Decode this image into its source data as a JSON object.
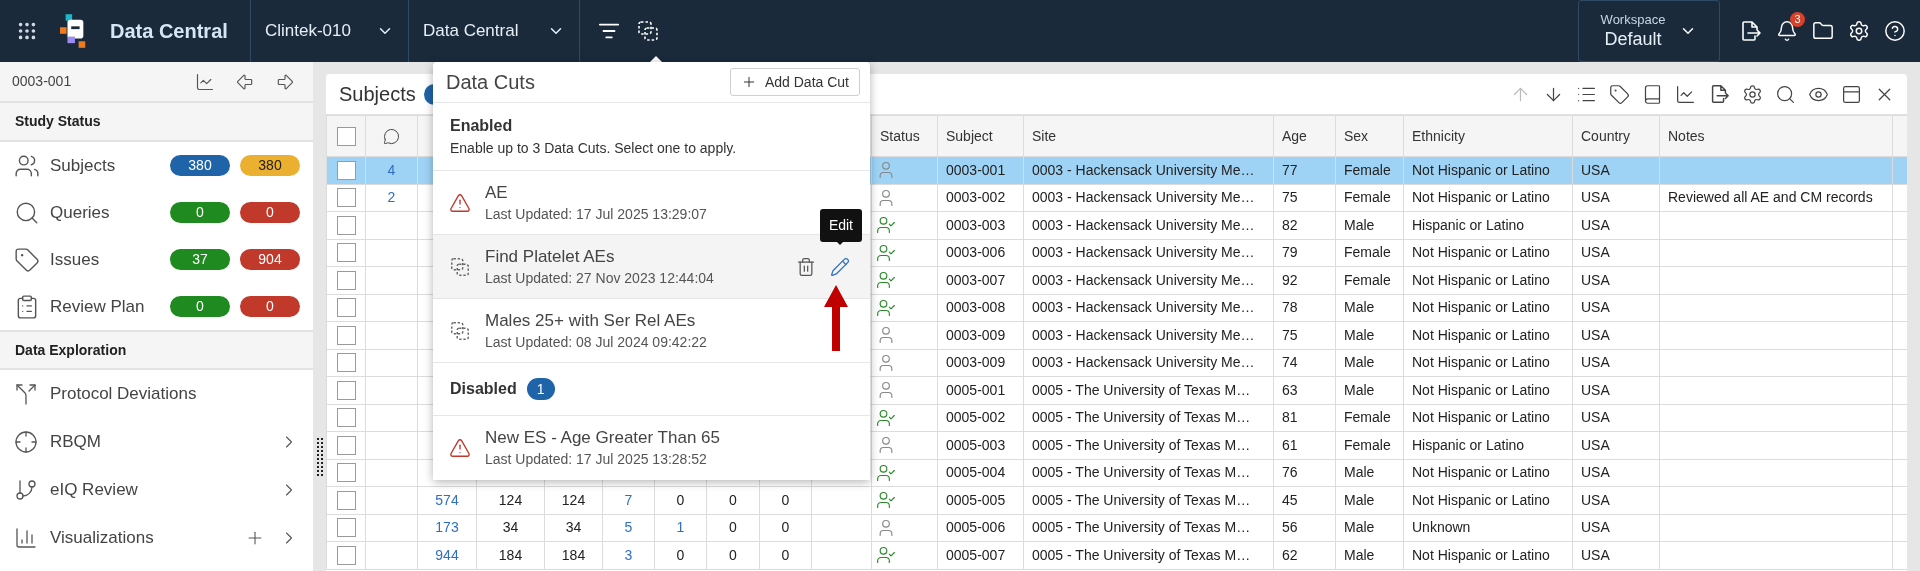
{
  "top_bar": {
    "app_title": "Data Central",
    "study": "Clintek-010",
    "module": "Data Central",
    "workspace": {
      "label": "Workspace",
      "value": "Default"
    },
    "notification_count": "3"
  },
  "sidebar": {
    "subject_id": "0003-001",
    "study_status": {
      "title": "Study Status",
      "items": [
        {
          "label": "Subjects",
          "counts": [
            {
              "value": "380",
              "color": "#1f64a8"
            },
            {
              "value": "380",
              "color": "#ebb02f"
            }
          ]
        },
        {
          "label": "Queries",
          "counts": [
            {
              "value": "0",
              "color": "#1f8a1f"
            },
            {
              "value": "0",
              "color": "#c0392b"
            }
          ]
        },
        {
          "label": "Issues",
          "counts": [
            {
              "value": "37",
              "color": "#1f8a1f"
            },
            {
              "value": "904",
              "color": "#c0392b"
            }
          ]
        },
        {
          "label": "Review Plan",
          "counts": [
            {
              "value": "0",
              "color": "#1f8a1f"
            },
            {
              "value": "0",
              "color": "#c0392b"
            }
          ]
        }
      ]
    },
    "data_exploration": {
      "title": "Data Exploration",
      "items": [
        {
          "label": "Protocol Deviations",
          "has_submenu": false,
          "can_add": false
        },
        {
          "label": "RBQM",
          "has_submenu": true,
          "can_add": false
        },
        {
          "label": "eIQ Review",
          "has_submenu": true,
          "can_add": false
        },
        {
          "label": "Visualizations",
          "has_submenu": true,
          "can_add": true
        }
      ]
    }
  },
  "panel": {
    "title": "Subjects",
    "table": {
      "header_checkbox": {
        "checked": false
      },
      "columns": [
        "Status",
        "Subject",
        "Site",
        "Age",
        "Sex",
        "Ethnicity",
        "Country",
        "Notes"
      ],
      "rows": [
        {
          "selected": true,
          "checked": false,
          "comments": "4",
          "verified": false,
          "subject": "0003-001",
          "site": "0003 - Hackensack University Me…",
          "age": "77",
          "sex": "Female",
          "ethnicity": "Not Hispanic or Latino",
          "country": "USA"
        },
        {
          "selected": false,
          "checked": false,
          "comments": "2",
          "verified": false,
          "subject": "0003-002",
          "site": "0003 - Hackensack University Me…",
          "age": "75",
          "sex": "Female",
          "ethnicity": "Not Hispanic or Latino",
          "country": "USA",
          "notes": "Reviewed all AE and CM records"
        },
        {
          "selected": false,
          "checked": false,
          "verified": true,
          "subject": "0003-003",
          "site": "0003 - Hackensack University Me…",
          "age": "82",
          "sex": "Male",
          "ethnicity": "Hispanic or Latino",
          "country": "USA"
        },
        {
          "selected": false,
          "checked": false,
          "verified": true,
          "subject": "0003-006",
          "site": "0003 - Hackensack University Me…",
          "age": "79",
          "sex": "Female",
          "ethnicity": "Not Hispanic or Latino",
          "country": "USA"
        },
        {
          "selected": false,
          "checked": false,
          "verified": true,
          "subject": "0003-007",
          "site": "0003 - Hackensack University Me…",
          "age": "92",
          "sex": "Female",
          "ethnicity": "Not Hispanic or Latino",
          "country": "USA"
        },
        {
          "selected": false,
          "checked": false,
          "verified": true,
          "subject": "0003-008",
          "site": "0003 - Hackensack University Me…",
          "age": "78",
          "sex": "Male",
          "ethnicity": "Not Hispanic or Latino",
          "country": "USA"
        },
        {
          "selected": false,
          "checked": false,
          "verified": false,
          "subject": "0003-009",
          "site": "0003 - Hackensack University Me…",
          "age": "75",
          "sex": "Male",
          "ethnicity": "Not Hispanic or Latino",
          "country": "USA"
        },
        {
          "selected": false,
          "checked": false,
          "verified": false,
          "subject": "0003-009",
          "site": "0003 - Hackensack University Me…",
          "age": "74",
          "sex": "Male",
          "ethnicity": "Not Hispanic or Latino",
          "country": "USA"
        },
        {
          "selected": false,
          "checked": false,
          "verified": false,
          "subject": "0005-001",
          "site": "0005 - The University of Texas M…",
          "age": "63",
          "sex": "Male",
          "ethnicity": "Not Hispanic or Latino",
          "country": "USA"
        },
        {
          "selected": false,
          "checked": false,
          "verified": true,
          "subject": "0005-002",
          "site": "0005 - The University of Texas M…",
          "age": "81",
          "sex": "Female",
          "ethnicity": "Not Hispanic or Latino",
          "country": "USA"
        },
        {
          "selected": false,
          "checked": false,
          "verified": false,
          "subject": "0005-003",
          "site": "0005 - The University of Texas M…",
          "age": "61",
          "sex": "Female",
          "ethnicity": "Hispanic or Latino",
          "country": "USA"
        },
        {
          "selected": false,
          "checked": false,
          "verified": true,
          "subject": "0005-004",
          "site": "0005 - The University of Texas M…",
          "age": "76",
          "sex": "Male",
          "ethnicity": "Not Hispanic or Latino",
          "country": "USA"
        },
        {
          "selected": false,
          "checked": false,
          "verified": true,
          "counts": [
            {
              "value": "574",
              "link": true
            },
            {
              "value": "124",
              "link": false
            },
            {
              "value": "124",
              "link": false
            },
            {
              "value": "7",
              "link": true
            },
            {
              "value": "0",
              "link": false
            },
            {
              "value": "0",
              "link": false
            },
            {
              "value": "0",
              "link": false
            }
          ],
          "subject": "0005-005",
          "site": "0005 - The University of Texas M…",
          "age": "45",
          "sex": "Male",
          "ethnicity": "Not Hispanic or Latino",
          "country": "USA"
        },
        {
          "selected": false,
          "checked": false,
          "verified": false,
          "counts": [
            {
              "value": "173",
              "link": true
            },
            {
              "value": "34",
              "link": false
            },
            {
              "value": "34",
              "link": false
            },
            {
              "value": "5",
              "link": true
            },
            {
              "value": "1",
              "link": true
            },
            {
              "value": "0",
              "link": false
            },
            {
              "value": "0",
              "link": false
            }
          ],
          "subject": "0005-006",
          "site": "0005 - The University of Texas M…",
          "age": "56",
          "sex": "Male",
          "ethnicity": "Unknown",
          "country": "USA"
        },
        {
          "selected": false,
          "checked": false,
          "verified": true,
          "counts": [
            {
              "value": "944",
              "link": true
            },
            {
              "value": "184",
              "link": false
            },
            {
              "value": "184",
              "link": false
            },
            {
              "value": "3",
              "link": true
            },
            {
              "value": "0",
              "link": false
            },
            {
              "value": "0",
              "link": false
            },
            {
              "value": "0",
              "link": false
            }
          ],
          "subject": "0005-007",
          "site": "0005 - The University of Texas M…",
          "age": "62",
          "sex": "Male",
          "ethnicity": "Not Hispanic or Latino",
          "country": "USA"
        }
      ]
    }
  },
  "data_cuts_popup": {
    "title": "Data Cuts",
    "add_button": "Add Data Cut",
    "enabled": {
      "title": "Enabled",
      "description": "Enable up to 3 Data Cuts. Select one to apply.",
      "items": [
        {
          "kind": "warning",
          "name": "AE",
          "updated": "Last Updated: 17 Jul 2025 13:29:07",
          "hovered": false
        },
        {
          "kind": "cut",
          "name": "Find Platelet AEs",
          "updated": "Last Updated: 27 Nov 2023 12:44:04",
          "hovered": true,
          "tooltip": "Edit"
        },
        {
          "kind": "cut",
          "name": "Males 25+ with Ser Rel AEs",
          "updated": "Last Updated: 08 Jul 2024 09:42:22",
          "hovered": false
        }
      ]
    },
    "disabled": {
      "title": "Disabled",
      "count": "1",
      "items": [
        {
          "kind": "warning",
          "name": "New ES - Age Greater Than 65",
          "updated": "Last Updated: 17 Jul 2025 13:28:52",
          "hovered": false
        }
      ]
    }
  }
}
